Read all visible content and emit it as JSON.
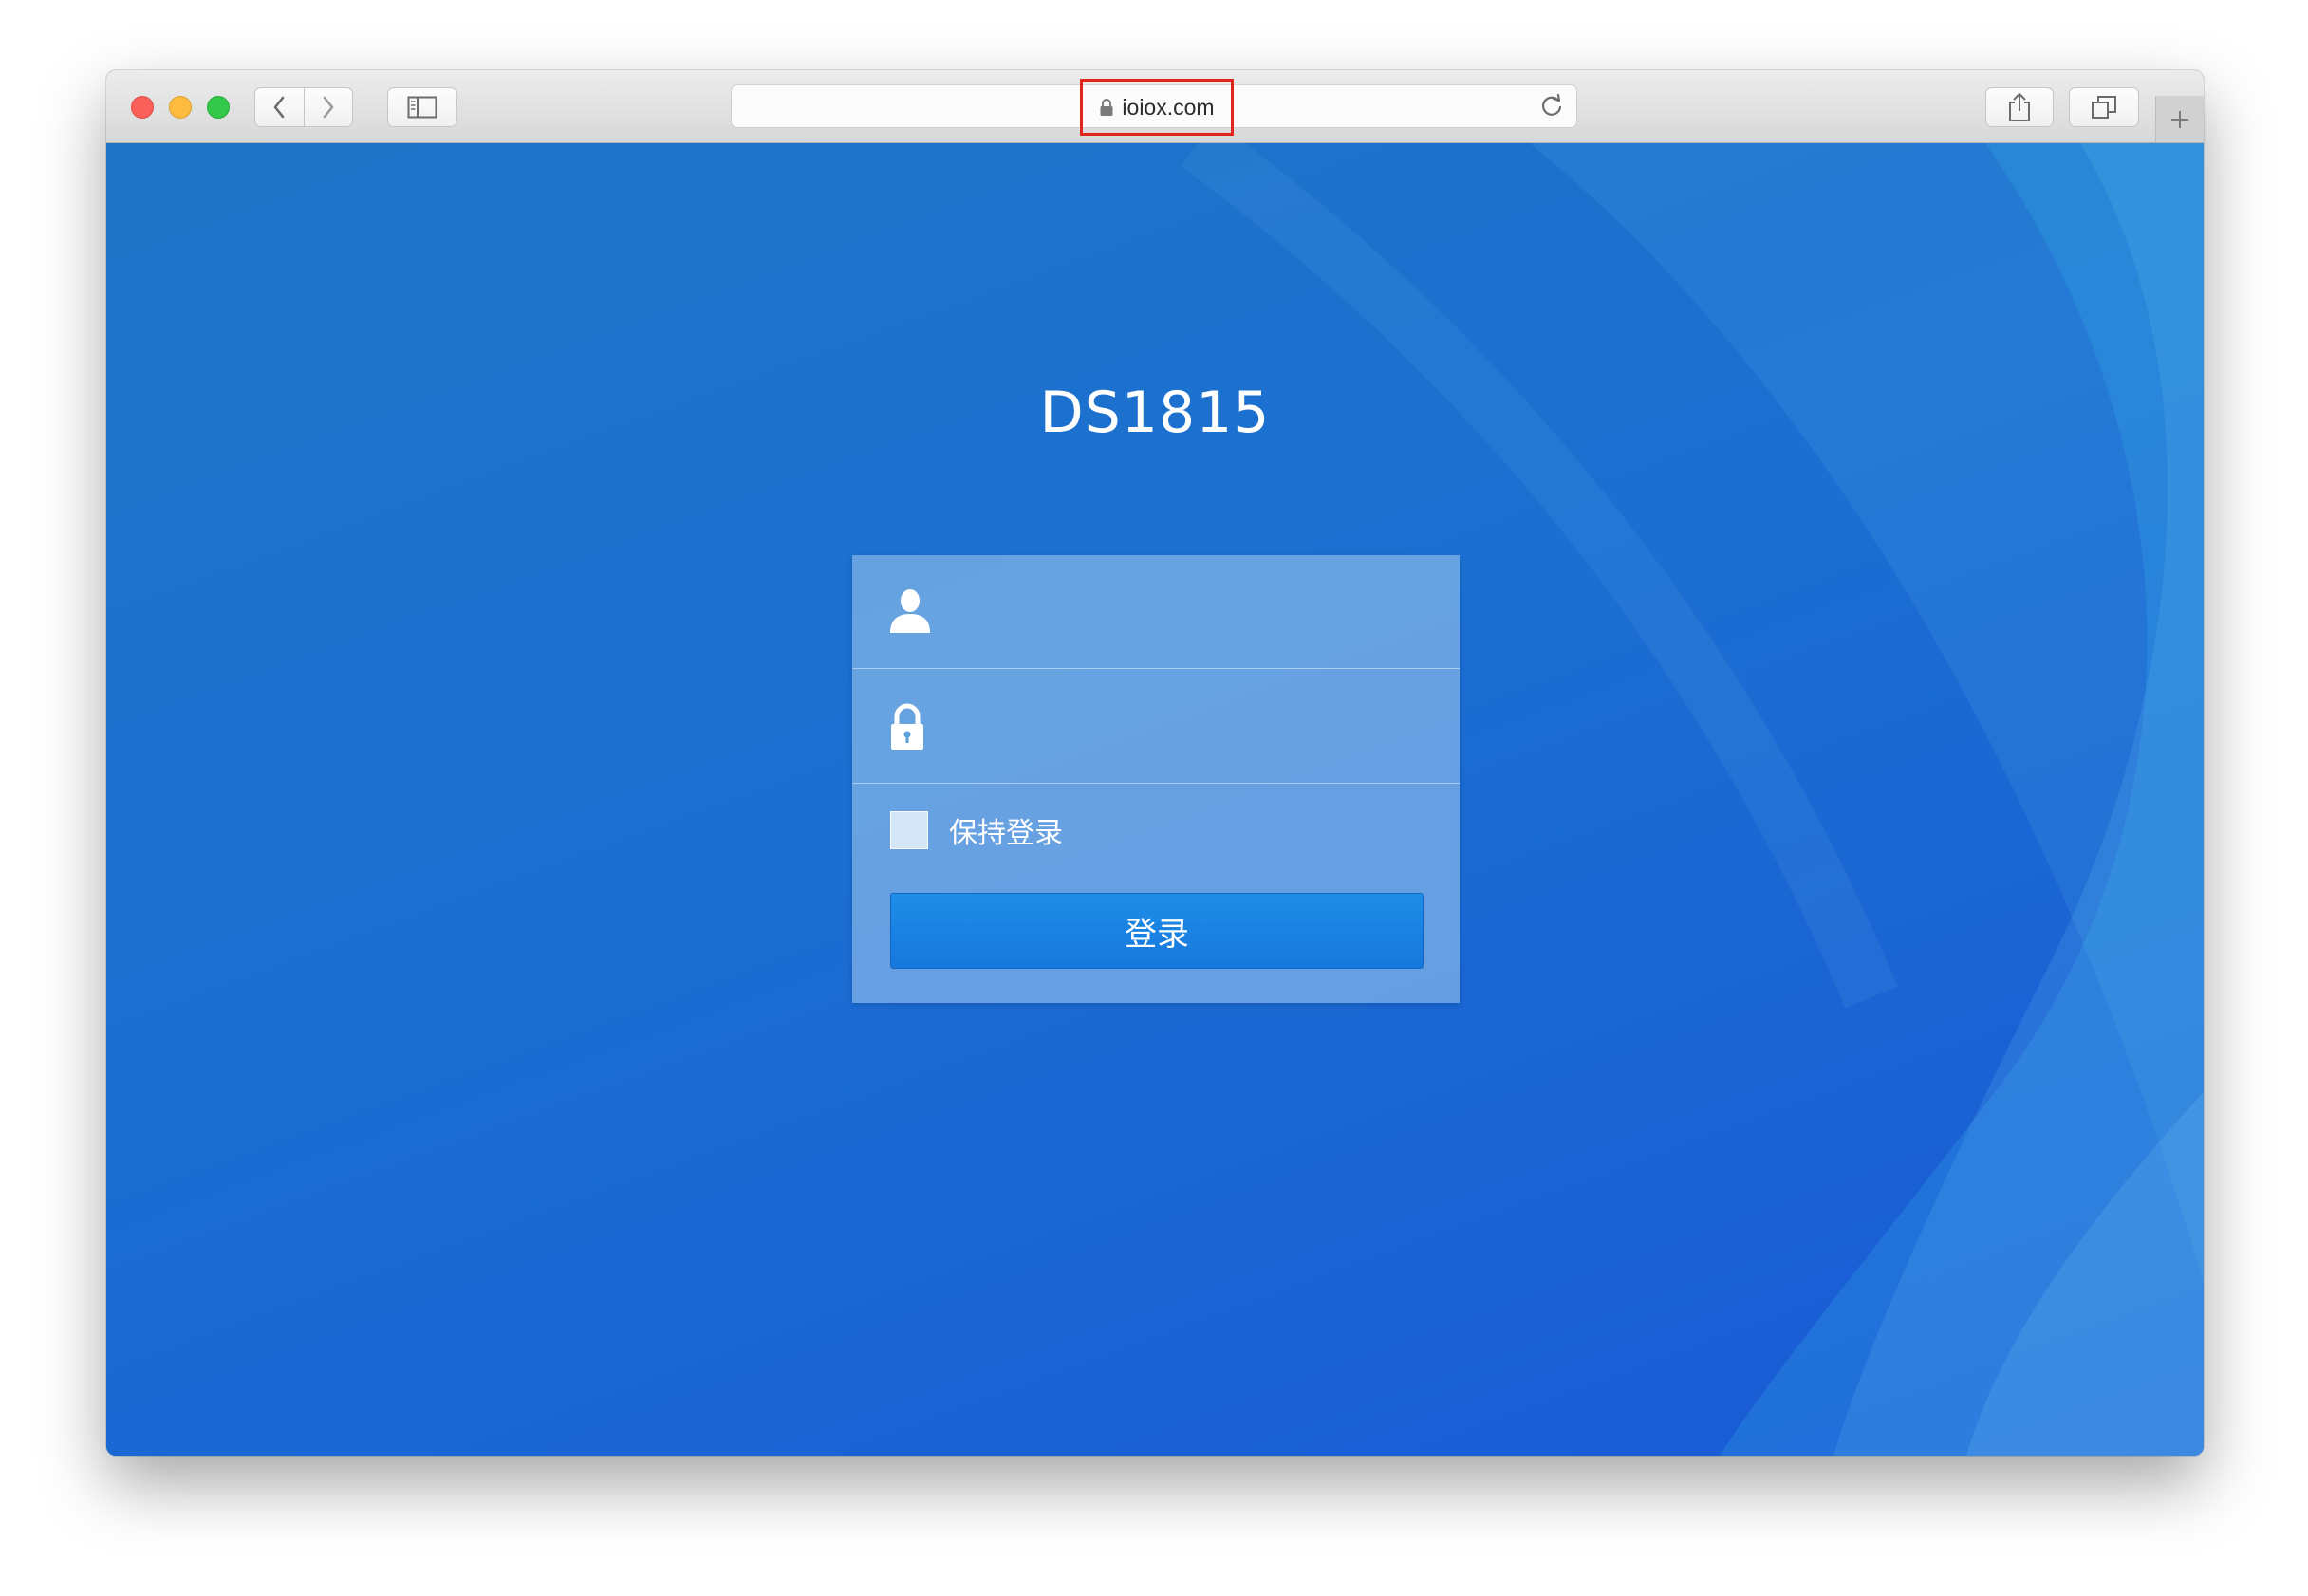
{
  "browser": {
    "url": "ioiox.com",
    "icons": {
      "close": "close-traffic-light",
      "minimize": "minimize-traffic-light",
      "maximize": "maximize-traffic-light",
      "back": "chevron-left-icon",
      "forward": "chevron-right-icon",
      "sidebar": "sidebar-icon",
      "lock": "lock-icon",
      "reload": "reload-icon",
      "share": "share-icon",
      "tabs": "tabs-icon",
      "new_tab": "plus-icon"
    }
  },
  "login": {
    "title": "DS1815",
    "username_placeholder": "",
    "password_placeholder": "",
    "remember_label": "保持登录",
    "remember_checked": false,
    "submit_label": "登录"
  },
  "colors": {
    "page_background": "#1b6fd2",
    "button": "#1677dc",
    "url_highlight": "#e0261f"
  }
}
